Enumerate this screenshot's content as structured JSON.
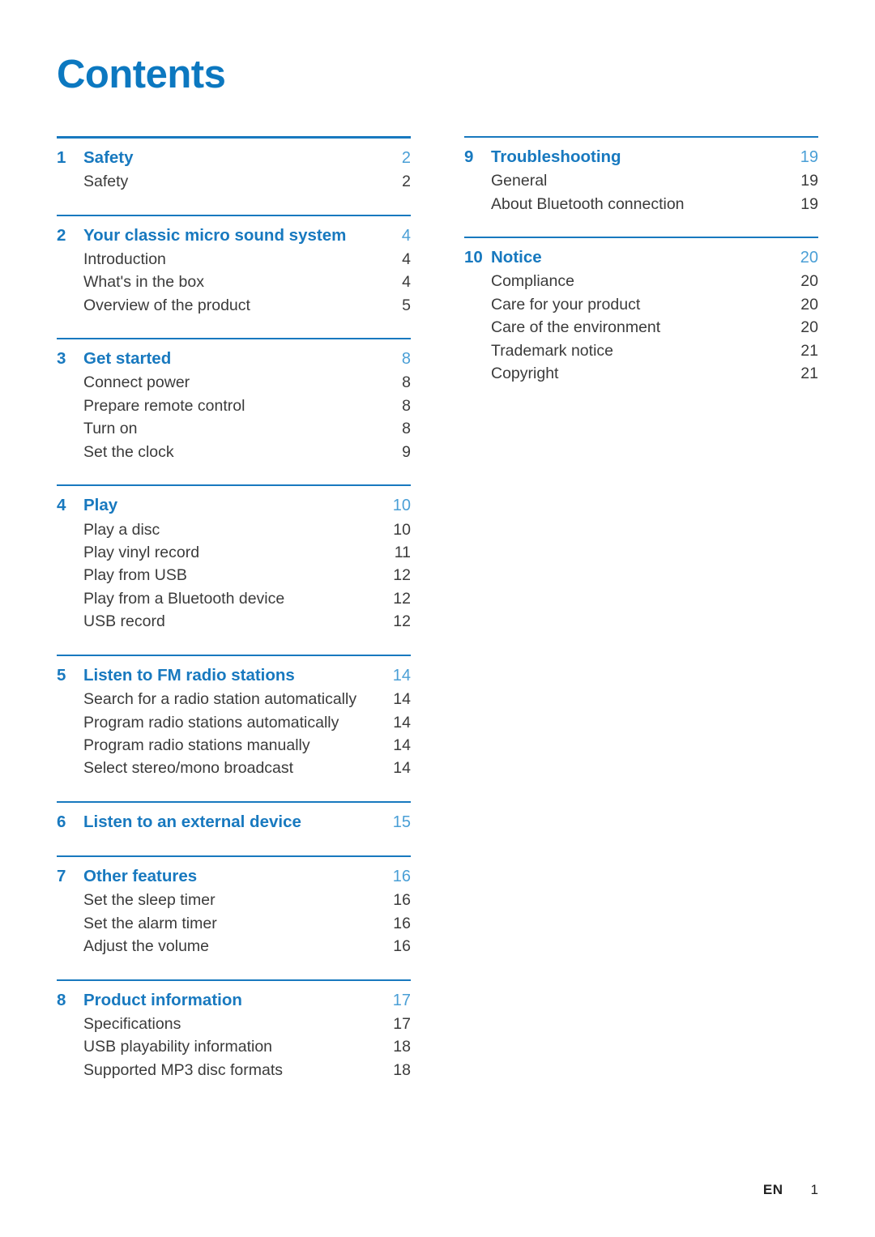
{
  "document": {
    "title": "Contents",
    "accent_color": "#1879bf",
    "heading_color": "#0c78c0",
    "subitem_color": "#3b3b3b",
    "page_number_color": "#4a9fd6"
  },
  "footer": {
    "language": "EN",
    "page": "1"
  },
  "columns": [
    {
      "sections": [
        {
          "number": "1",
          "title": "Safety",
          "page": "2",
          "items": [
            {
              "label": "Safety",
              "page": "2"
            }
          ]
        },
        {
          "number": "2",
          "title": "Your classic micro sound system",
          "page": "4",
          "items": [
            {
              "label": "Introduction",
              "page": "4"
            },
            {
              "label": "What's in the box",
              "page": "4"
            },
            {
              "label": "Overview of the product",
              "page": "5"
            }
          ]
        },
        {
          "number": "3",
          "title": "Get started",
          "page": "8",
          "items": [
            {
              "label": "Connect power",
              "page": "8"
            },
            {
              "label": "Prepare remote control",
              "page": "8"
            },
            {
              "label": "Turn on",
              "page": "8"
            },
            {
              "label": "Set the clock",
              "page": "9"
            }
          ]
        },
        {
          "number": "4",
          "title": "Play",
          "page": "10",
          "items": [
            {
              "label": "Play a disc",
              "page": "10"
            },
            {
              "label": "Play vinyl record",
              "page": "11"
            },
            {
              "label": "Play from USB",
              "page": "12"
            },
            {
              "label": "Play from a Bluetooth device",
              "page": "12"
            },
            {
              "label": "USB record",
              "page": "12"
            }
          ]
        },
        {
          "number": "5",
          "title": "Listen to FM radio stations",
          "page": "14",
          "items": [
            {
              "label": "Search for a radio station automatically",
              "page": "14"
            },
            {
              "label": "Program radio stations automatically",
              "page": "14"
            },
            {
              "label": "Program radio stations manually",
              "page": "14"
            },
            {
              "label": "Select stereo/mono broadcast",
              "page": "14"
            }
          ]
        },
        {
          "number": "6",
          "title": "Listen to an external device",
          "page": "15",
          "items": []
        },
        {
          "number": "7",
          "title": "Other features",
          "page": "16",
          "items": [
            {
              "label": "Set the sleep timer",
              "page": "16"
            },
            {
              "label": "Set the alarm timer",
              "page": "16"
            },
            {
              "label": "Adjust the volume",
              "page": "16"
            }
          ]
        },
        {
          "number": "8",
          "title": "Product information",
          "page": "17",
          "items": [
            {
              "label": "Specifications",
              "page": "17"
            },
            {
              "label": "USB playability information",
              "page": "18"
            },
            {
              "label": "Supported MP3 disc formats",
              "page": "18"
            }
          ]
        }
      ]
    },
    {
      "sections": [
        {
          "number": "9",
          "title": "Troubleshooting",
          "page": "19",
          "items": [
            {
              "label": "General",
              "page": "19"
            },
            {
              "label": "About Bluetooth connection",
              "page": "19"
            }
          ]
        },
        {
          "number": "10",
          "title": "Notice",
          "page": "20",
          "items": [
            {
              "label": "Compliance",
              "page": "20"
            },
            {
              "label": "Care for your product",
              "page": "20"
            },
            {
              "label": "Care of the environment",
              "page": "20"
            },
            {
              "label": "Trademark notice",
              "page": "21"
            },
            {
              "label": "Copyright",
              "page": "21"
            }
          ]
        }
      ]
    }
  ]
}
